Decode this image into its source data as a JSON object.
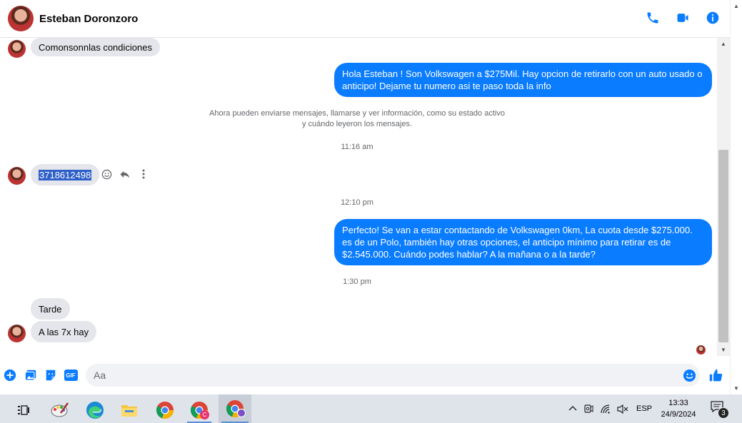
{
  "header": {
    "contact_name": "Esteban Doronzoro",
    "icons": [
      "phone-icon",
      "video-call-icon",
      "info-icon"
    ]
  },
  "thread": {
    "msg1_in": "Comonsonnlas condiciones",
    "msg2_out": "Hola Esteban ! Son Volkswagen a $275Mil. Hay opcion de retirarlo con un auto usado o anticipo! Dejame tu numero asi te paso toda la info",
    "system_note_line1": "Ahora pueden enviarse mensajes, llamarse y ver información, como su estado activo",
    "system_note_line2": "y cuándo leyeron los mensajes.",
    "time1": "11:16 am",
    "msg3_in": "3718612498",
    "time2": "12:10 pm",
    "msg4_out": "Perfecto!  Se van a estar contactando de Volkswagen 0km, La cuota desde $275.000. es de un Polo, también hay otras opciones, el anticipo mínimo para retirar es de $2.545.000. Cuándo podes hablar? A la mañana o a la tarde?",
    "time3": "1:30 pm",
    "msg5_in": "Tarde",
    "msg6_in": "A las 7x hay"
  },
  "composer": {
    "placeholder": "Aa",
    "icons": [
      "add-icon",
      "photo-icon",
      "sticker-icon",
      "gif-icon",
      "emoji-icon",
      "like-icon"
    ],
    "gif_label": "GIF"
  },
  "taskbar": {
    "lang": "ESP",
    "time": "13:33",
    "date": "24/9/2024",
    "notification_count": "3",
    "chrome_badge": "C"
  },
  "colors": {
    "accent": "#0a7cff",
    "incoming_bubble": "#e4e6eb",
    "taskbar": "#dfe3ea"
  }
}
